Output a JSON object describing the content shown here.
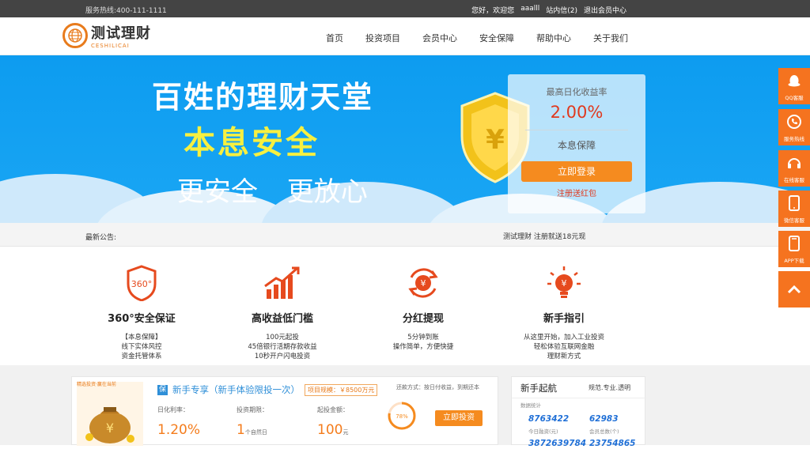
{
  "topbar": {
    "hotline": "服务热线:400-111-1111",
    "greeting": "您好，欢迎您",
    "username": "aaalll",
    "messages": "站内信(2)",
    "logout": "退出会员中心"
  },
  "logo": {
    "cn": "测试理财",
    "en": "CESHILICAI"
  },
  "nav": [
    "首页",
    "投资项目",
    "会员中心",
    "安全保障",
    "帮助中心",
    "关于我们"
  ],
  "banner": {
    "line1": "百姓的理财天堂",
    "line2": "本息安全",
    "line3": "更安全 更放心",
    "colors": {
      "background": "#0d9cf0",
      "highlight": "#f7f040"
    }
  },
  "loginbox": {
    "label": "最高日化收益率",
    "rate": "2.00%",
    "guarantee": "本息保障",
    "login_button": "立即登录",
    "register": "注册送红包"
  },
  "notice": {
    "label": "最新公告:",
    "text": "测试理财 注册就送18元现"
  },
  "features": [
    {
      "icon": "shield-360-icon",
      "title": "360°安全保证",
      "lines": [
        "【本息保障】",
        "线下实体风控",
        "资金托管体系"
      ]
    },
    {
      "icon": "rising-chart-icon",
      "title": "高收益低门槛",
      "lines": [
        "100元起投",
        "45倍银行活期存款收益",
        "10秒开户闪电投资"
      ]
    },
    {
      "icon": "yen-cycle-icon",
      "title": "分红提现",
      "lines": [
        "5分钟到账",
        "操作简单，方便快捷"
      ]
    },
    {
      "icon": "yen-bulb-icon",
      "title": "新手指引",
      "lines": [
        "从这里开始，加入工业投资",
        "轻松体验互联网金融",
        "理财新方式"
      ]
    }
  ],
  "product": {
    "image_caption": "精选投资·赢在当前",
    "tag": "保",
    "name": "新手专享（新手体验限投一次）",
    "scale": "项目规模：￥8500万元",
    "payment": "还款方式：按日付收益，到期还本",
    "rate_label": "日化利率：",
    "rate_value": "1.20%",
    "term_label": "投资期限：",
    "term_value": "1",
    "term_unit": "个自然日",
    "min_label": "起投金额：",
    "min_value": "100",
    "min_unit": "元",
    "progress_text": "78%",
    "progress": 0.78,
    "invest_button": "立即投资"
  },
  "guide": {
    "title": "新手起航",
    "slogan": "规范.专业.透明",
    "stats_label": "数据统计",
    "n1": "8763422",
    "c1": "今日融资(元)",
    "n2": "62983",
    "c2": "会员总数(个)",
    "n3": "3872639784",
    "n4": "23754865"
  },
  "sidebar": [
    {
      "icon": "qq-penguin-icon",
      "label": "QQ客服"
    },
    {
      "icon": "phone-icon",
      "label": "服务热线"
    },
    {
      "icon": "headset-icon",
      "label": "在线客服"
    },
    {
      "icon": "mobile-icon",
      "label": "微信客服"
    },
    {
      "icon": "app-phone-icon",
      "label": "APP下载"
    },
    {
      "icon": "chevron-up-icon",
      "label": ""
    }
  ]
}
